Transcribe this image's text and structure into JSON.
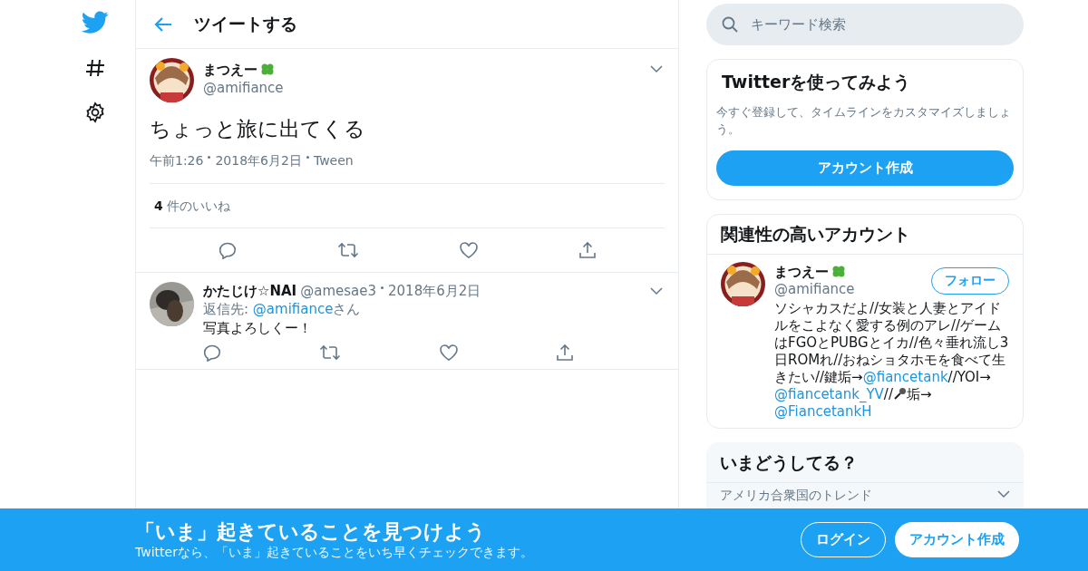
{
  "header": {
    "title": "ツイートする"
  },
  "tweet": {
    "name": "まつえー",
    "handle": "@amifiance",
    "text": "ちょっと旅に出てくる",
    "meta": [
      "午前1:26",
      "2018年6月2日",
      "Tween"
    ],
    "likes_count": "4",
    "likes_label": "件のいいね"
  },
  "replies": [
    {
      "name": "かたじけ☆NAI",
      "handle": "@amesae3",
      "date": "2018年6月2日",
      "reply_prefix": "返信先:",
      "reply_to": "@amifiance",
      "reply_suffix": "さん",
      "text": "写真よろしくー！"
    }
  ],
  "search": {
    "placeholder": "キーワード検索"
  },
  "signup_card": {
    "title": "Twitterを使ってみよう",
    "text": "今すぐ登録して、タイムラインをカスタマイズしましょう。",
    "button": "アカウント作成"
  },
  "related": {
    "title": "関連性の高いアカウント",
    "accounts": [
      {
        "name": "まつえー",
        "handle": "@amifiance",
        "follow": "フォロー",
        "bio": [
          {
            "kind": "text",
            "text": "ソシャカスだよ//女装と人妻とアイドルをこよなく愛する例のアレ//ゲームはFGOとPUBGとイカ//色々垂れ流し3日ROMれ//おねショタホモを食べて生きたい//鍵垢→"
          },
          {
            "kind": "link",
            "text": "@fiancetank"
          },
          {
            "kind": "text",
            "text": "//YOI→"
          },
          {
            "kind": "link",
            "text": "@fiancetank_YV"
          },
          {
            "kind": "text",
            "text": "//"
          },
          {
            "kind": "icon"
          },
          {
            "kind": "text",
            "text": "垢→"
          },
          {
            "kind": "link",
            "text": "@FiancetankH"
          }
        ]
      }
    ]
  },
  "trends": {
    "title": "いまどうしてる？",
    "subtitle": "アメリカ合衆国のトレンド"
  },
  "banner": {
    "title": "「いま」起きていることを見つけよう",
    "text": "Twitterなら、「いま」起きていることをいち早くチェックできます。",
    "login": "ログイン",
    "signup": "アカウント作成"
  }
}
